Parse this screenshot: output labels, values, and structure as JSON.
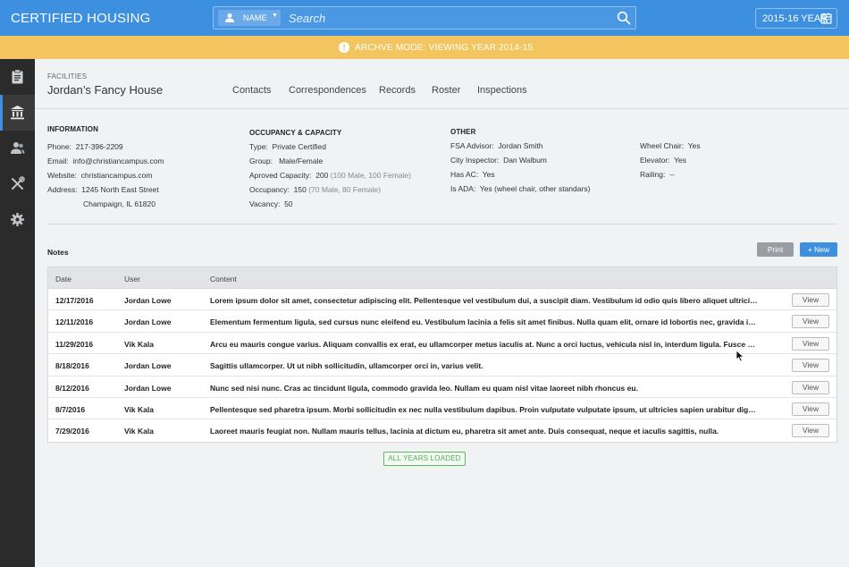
{
  "app": {
    "title": "CERTIFIED HOUSING"
  },
  "search": {
    "type_label": "NAME",
    "placeholder": "Search"
  },
  "year_selector": {
    "label": "2015-16 YEAR"
  },
  "banner": {
    "text": "ARCHVE MODE: VIEWING YEAR 2014-15",
    "color": "#f2c55e"
  },
  "colors": {
    "primary": "#3d8fe0",
    "sidebar": "#2b2b2b",
    "success": "#5cb85c"
  },
  "sidebar": {
    "items": [
      {
        "icon": "clipboard-icon"
      },
      {
        "icon": "building-icon",
        "active": true
      },
      {
        "icon": "users-icon"
      },
      {
        "icon": "tools-icon"
      },
      {
        "icon": "gear-icon"
      }
    ]
  },
  "header": {
    "breadcrumb": "FACILITIES",
    "title": "Jordan’s Fancy House",
    "tabs": [
      "Contacts",
      "Correspondences",
      "Records",
      "Roster",
      "Inspections"
    ]
  },
  "information": {
    "heading": "INFORMATION",
    "phone_label": "Phone:",
    "phone": "217-396-2209",
    "email_label": "Email:",
    "email": "info@christiancampus.com",
    "website_label": "Website:",
    "website": "christiancampus.com",
    "address_label": "Address:",
    "address1": "1245 North East Street",
    "address2": "Champaign, IL 61820"
  },
  "occupancy": {
    "heading": "OCCUPANCY & CAPACITY",
    "type_label": "Type:",
    "type": "Private Certified",
    "group_label": "Group:",
    "group": "Male/Female",
    "capacity_label": "Aproved Capacity:",
    "capacity": "200",
    "capacity_detail": "(100 Male, 100 Female)",
    "occupancy_label": "Occupancy:",
    "occupancy": "150",
    "occupancy_detail": "(70 Male, 80 Female)",
    "vacancy_label": "Vacancy:",
    "vacancy": "50"
  },
  "other": {
    "heading": "OTHER",
    "fsa_label": "FSA Advisor:",
    "fsa": "Jordan Smith",
    "inspector_label": "City Inspector:",
    "inspector": "Dan Walbum",
    "ac_label": "Has AC:",
    "ac": "Yes",
    "ada_label": "Is ADA:",
    "ada": "Yes (wheel chair,  other standars)",
    "wheelchair_label": "Wheel Chair:",
    "wheelchair": "Yes",
    "elevator_label": "Elevator:",
    "elevator": "Yes",
    "railing_label": "Railing:",
    "railing": "--"
  },
  "notes": {
    "heading": "Notes",
    "print_label": "Print",
    "new_label": "+  New",
    "columns": [
      "Date",
      "User",
      "Content"
    ],
    "view_label": "View",
    "rows": [
      {
        "date": "12/17/2016",
        "user": "Jordan Lowe",
        "content": "Lorem ipsum dolor sit amet, consectetur adipiscing elit. Pellentesque vel vestibulum dui, a suscipit diam. Vestibulum id odio quis libero aliquet ultricies. Maecenas..."
      },
      {
        "date": "12/11/2016",
        "user": "Jordan Lowe",
        "content": "Elementum fermentum ligula, sed cursus nunc eleifend eu. Vestibulum lacinia a felis sit amet finibus. Nulla quam elit, ornare id lobortis nec, gravida in velit. Curabi..."
      },
      {
        "date": "11/29/2016",
        "user": "Vik Kala",
        "content": "Arcu eu mauris congue varius. Aliquam convallis ex erat, eu ullamcorper metus iaculis at. Nunc a orci luctus, vehicula nisl in, interdum ligula. Fusce ut elit mattis le..."
      },
      {
        "date": "8/18/2016",
        "user": "Jordan Lowe",
        "content": "Sagittis ullamcorper. Ut ut nibh sollicitudin, ullamcorper orci in, varius velit."
      },
      {
        "date": "8/12/2016",
        "user": "Jordan Lowe",
        "content": "Nunc sed nisi nunc. Cras ac tincidunt ligula, commodo gravida leo. Nullam eu quam nisl vitae laoreet nibh rhoncus eu."
      },
      {
        "date": "8/7/2016",
        "user": "Vik Kala",
        "content": "Pellentesque sed pharetra ipsum. Morbi sollicitudin ex nec nulla vestibulum dapibus. Proin vulputate vulputate ipsum, ut ultricies sapien urabitur dignissim risus..."
      },
      {
        "date": "7/29/2016",
        "user": "Vik Kala",
        "content": "Laoreet mauris feugiat non. Nullam mauris tellus, lacinia at dictum eu, pharetra sit amet ante. Duis consequat, neque et iaculis sagittis, nulla."
      }
    ],
    "status": "ALL YEARS LOADED"
  }
}
